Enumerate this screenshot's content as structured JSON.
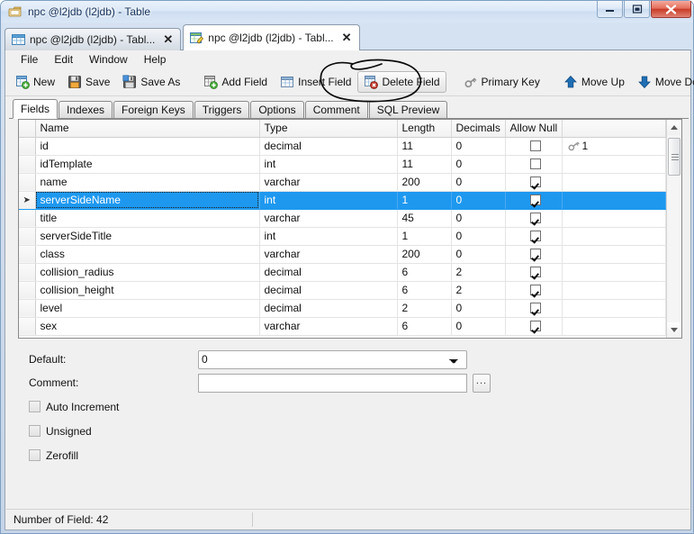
{
  "window": {
    "title": "npc @l2jdb (l2jdb) - Table",
    "icon": "table-window-icon",
    "buttons": {
      "minimize": "–",
      "maximize": "❐",
      "close": "✕"
    }
  },
  "doc_tabs": [
    {
      "label": "npc @l2jdb (l2jdb) - Tabl...",
      "icon": "table-grid-icon",
      "close": "✕",
      "active": false
    },
    {
      "label": "npc @l2jdb (l2jdb) - Tabl...",
      "icon": "table-design-icon",
      "close": "✕",
      "active": true
    }
  ],
  "menubar": [
    {
      "label": "File"
    },
    {
      "label": "Edit"
    },
    {
      "label": "Window"
    },
    {
      "label": "Help"
    }
  ],
  "toolbar": [
    {
      "label": "New",
      "icon": "new-table-icon",
      "hot": false
    },
    {
      "label": "Save",
      "icon": "save-disk-icon",
      "hot": false
    },
    {
      "label": "Save As",
      "icon": "save-as-disk-icon",
      "hot": false
    },
    {
      "sep": true
    },
    {
      "label": "Add Field",
      "icon": "add-field-icon",
      "hot": false
    },
    {
      "label": "Insert Field",
      "icon": "insert-field-icon",
      "hot": false
    },
    {
      "label": "Delete Field",
      "icon": "delete-field-icon",
      "hot": true
    },
    {
      "sep": true
    },
    {
      "label": "Primary Key",
      "icon": "primary-key-icon",
      "hot": false
    },
    {
      "sep": true
    },
    {
      "label": "Move Up",
      "icon": "arrow-up-icon",
      "hot": false
    },
    {
      "label": "Move Down",
      "icon": "arrow-down-icon",
      "hot": false
    }
  ],
  "page_tabs": [
    {
      "label": "Fields",
      "active": true
    },
    {
      "label": "Indexes",
      "active": false
    },
    {
      "label": "Foreign Keys",
      "active": false
    },
    {
      "label": "Triggers",
      "active": false
    },
    {
      "label": "Options",
      "active": false
    },
    {
      "label": "Comment",
      "active": false
    },
    {
      "label": "SQL Preview",
      "active": false
    }
  ],
  "grid": {
    "columns": [
      "Name",
      "Type",
      "Length",
      "Decimals",
      "Allow Null",
      ""
    ],
    "rows": [
      {
        "name": "id",
        "type": "decimal",
        "length": "11",
        "decimals": "0",
        "allow_null": false,
        "key": "1",
        "selected": false
      },
      {
        "name": "idTemplate",
        "type": "int",
        "length": "11",
        "decimals": "0",
        "allow_null": false,
        "key": "",
        "selected": false
      },
      {
        "name": "name",
        "type": "varchar",
        "length": "200",
        "decimals": "0",
        "allow_null": true,
        "key": "",
        "selected": false
      },
      {
        "name": "serverSideName",
        "type": "int",
        "length": "1",
        "decimals": "0",
        "allow_null": true,
        "key": "",
        "selected": true
      },
      {
        "name": "title",
        "type": "varchar",
        "length": "45",
        "decimals": "0",
        "allow_null": true,
        "key": "",
        "selected": false
      },
      {
        "name": "serverSideTitle",
        "type": "int",
        "length": "1",
        "decimals": "0",
        "allow_null": true,
        "key": "",
        "selected": false
      },
      {
        "name": "class",
        "type": "varchar",
        "length": "200",
        "decimals": "0",
        "allow_null": true,
        "key": "",
        "selected": false
      },
      {
        "name": "collision_radius",
        "type": "decimal",
        "length": "6",
        "decimals": "2",
        "allow_null": true,
        "key": "",
        "selected": false
      },
      {
        "name": "collision_height",
        "type": "decimal",
        "length": "6",
        "decimals": "2",
        "allow_null": true,
        "key": "",
        "selected": false
      },
      {
        "name": "level",
        "type": "decimal",
        "length": "2",
        "decimals": "0",
        "allow_null": true,
        "key": "",
        "selected": false
      },
      {
        "name": "sex",
        "type": "varchar",
        "length": "6",
        "decimals": "0",
        "allow_null": true,
        "key": "",
        "selected": false
      }
    ],
    "row_indicator": "➤"
  },
  "properties": {
    "default_label": "Default:",
    "default_value": "0",
    "default_options": [
      "0"
    ],
    "comment_label": "Comment:",
    "comment_value": "",
    "comment_placeholder": "",
    "browse_button": "...",
    "checkboxes": [
      {
        "label": "Auto Increment",
        "checked": false
      },
      {
        "label": "Unsigned",
        "checked": false
      },
      {
        "label": "Zerofill",
        "checked": false
      }
    ]
  },
  "statusbar": {
    "field_count_text": "Number of Field: 42"
  },
  "annotation": {
    "kind": "hand-drawn-ellipse",
    "target": "Delete Field",
    "color": "#000000"
  },
  "colors": {
    "selection": "#1e98ef",
    "title_text": "#16315a",
    "close_button": "#c83c28"
  }
}
